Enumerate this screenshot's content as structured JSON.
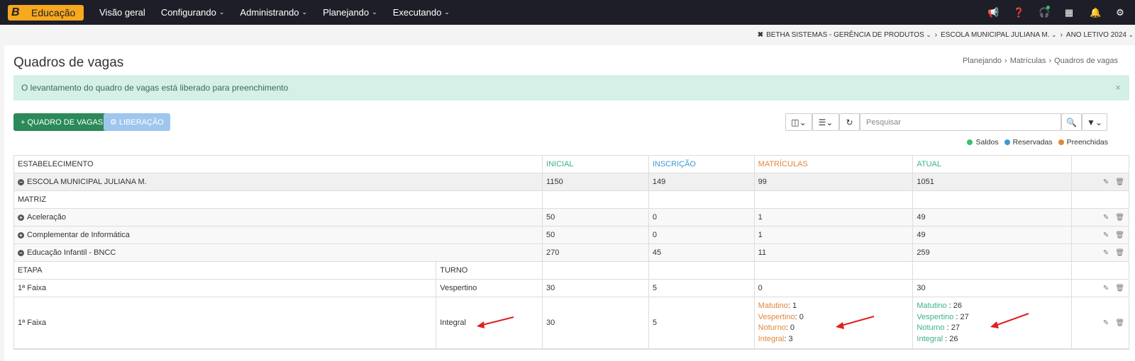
{
  "nav": {
    "logo_letter": "B",
    "logo_text": "Educação",
    "items": [
      {
        "label": "Visão geral",
        "has_caret": false
      },
      {
        "label": "Configurando",
        "has_caret": true
      },
      {
        "label": "Administrando",
        "has_caret": true
      },
      {
        "label": "Planejando",
        "has_caret": true
      },
      {
        "label": "Executando",
        "has_caret": true
      }
    ],
    "icons": [
      "megaphone-icon",
      "help-icon",
      "headset-icon",
      "apps-icon",
      "bell-icon",
      "settings-icon"
    ]
  },
  "context": {
    "entity": "BETHA SISTEMAS - GERÊNCIA DE PRODUTOS",
    "school": "ESCOLA MUNICIPAL JULIANA M.",
    "year": "ANO LETIVO 2024"
  },
  "page": {
    "title": "Quadros de vagas",
    "breadcrumb": [
      "Planejando",
      "Matrículas",
      "Quadros de vagas"
    ]
  },
  "alert": {
    "message": "O levantamento do quadro de vagas está liberado para preenchimento",
    "close": "×"
  },
  "toolbar": {
    "add_label": "QUADRO DE VAGAS",
    "release_label": "LIBERAÇÃO",
    "search_placeholder": "Pesquisar"
  },
  "legend": [
    {
      "label": "Saldos",
      "color": "#35c26e"
    },
    {
      "label": "Reservadas",
      "color": "#3a9ad4"
    },
    {
      "label": "Preenchidas",
      "color": "#e2873c"
    }
  ],
  "table": {
    "headers": {
      "estabelecimento": "ESTABELECIMENTO",
      "inicial": "INICIAL",
      "inscricao": "INSCRIÇÃO",
      "matriculas": "MATRÍCULAS",
      "atual": "ATUAL"
    },
    "school_row": {
      "name": "ESCOLA MUNICIPAL JULIANA M.",
      "inicial": "1150",
      "inscricao": "149",
      "matriculas": "99",
      "atual": "1051"
    },
    "matriz_label": "MATRIZ",
    "matriz_rows": [
      {
        "name": "Aceleração",
        "inicial": "50",
        "inscricao": "0",
        "matriculas": "1",
        "atual": "49",
        "expanded": false
      },
      {
        "name": "Complementar de Informática",
        "inicial": "50",
        "inscricao": "0",
        "matriculas": "1",
        "atual": "49",
        "expanded": false
      },
      {
        "name": "Educação Infantil - BNCC",
        "inicial": "270",
        "inscricao": "45",
        "matriculas": "11",
        "atual": "259",
        "expanded": true
      }
    ],
    "sub_headers": {
      "etapa": "ETAPA",
      "turno": "TURNO"
    },
    "sub_rows": [
      {
        "etapa": "1ª Faixa",
        "turno": "Vespertino",
        "inicial": "30",
        "inscricao": "5",
        "matriculas": "0",
        "atual": "30"
      },
      {
        "etapa": "1ª Faixa",
        "turno": "Integral",
        "inicial": "30",
        "inscricao": "5",
        "matriculas_breakdown": [
          {
            "label": "Matutino",
            "value": ": 1"
          },
          {
            "label": "Vespertino",
            "value": ": 0"
          },
          {
            "label": "Noturno",
            "value": ": 0"
          },
          {
            "label": "Integral",
            "value": ": 3"
          }
        ],
        "atual_breakdown": [
          {
            "label": "Matutino",
            "value": " : 26"
          },
          {
            "label": "Vespertino",
            "value": " : 27"
          },
          {
            "label": "Noturno",
            "value": " : 27"
          },
          {
            "label": "Integral",
            "value": " : 26"
          }
        ]
      }
    ]
  }
}
